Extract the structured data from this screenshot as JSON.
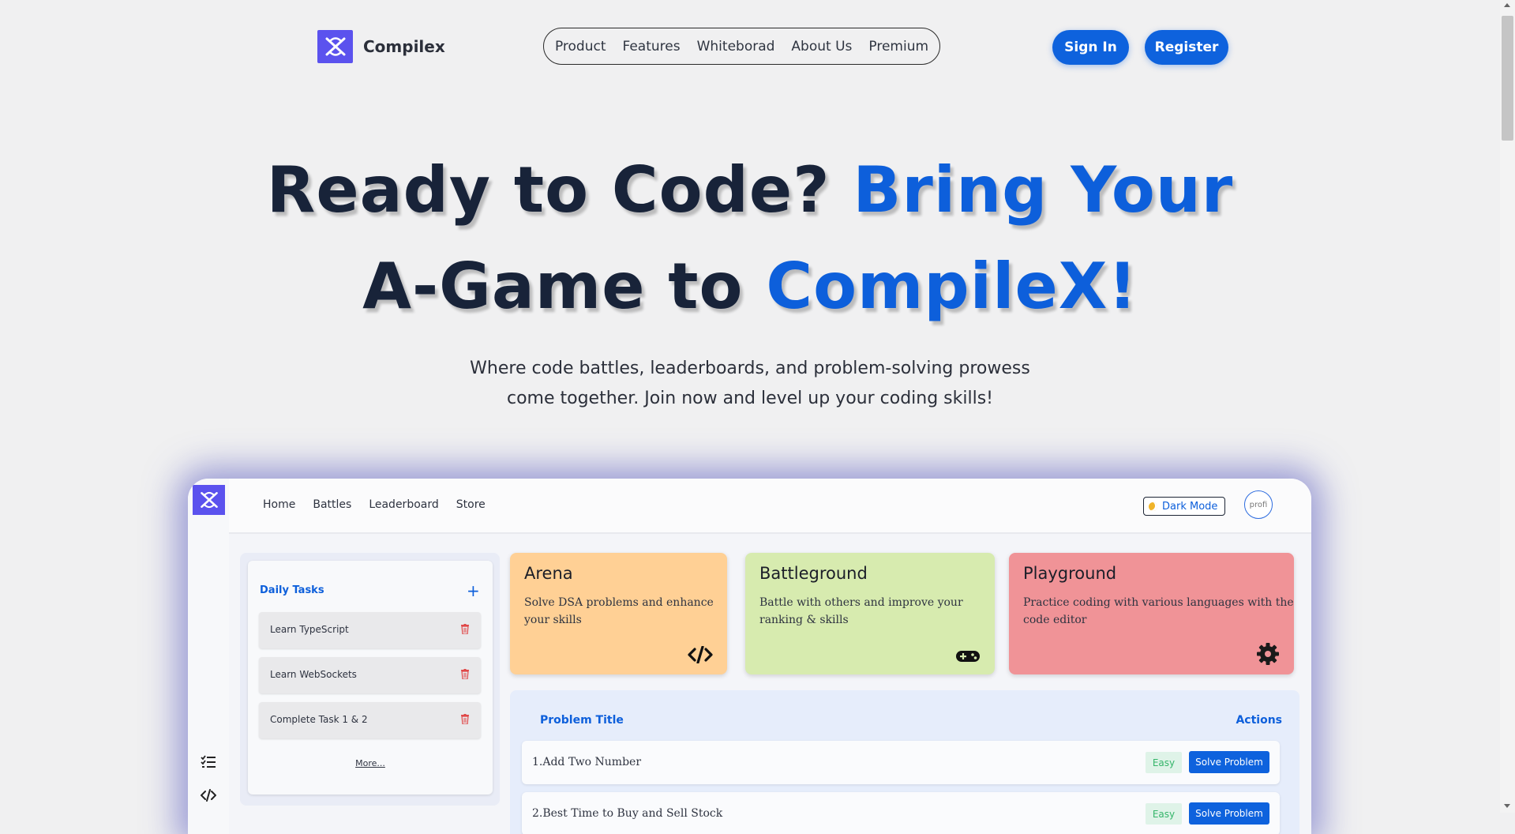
{
  "brand": {
    "name": "Compilex"
  },
  "nav": {
    "links": [
      "Product",
      "Features",
      "Whiteborad",
      "About Us",
      "Premium"
    ]
  },
  "auth": {
    "signin": "Sign In",
    "register": "Register"
  },
  "hero": {
    "title_part1": "Ready to Code? ",
    "title_accent1": "Bring Your",
    "title_part2": "A-Game to ",
    "title_accent2": "CompileX!",
    "subtitle_line1": "Where code battles, leaderboards, and problem-solving prowess",
    "subtitle_line2": "come together. Join now and level up your coding skills!"
  },
  "preview": {
    "menu": [
      "Home",
      "Battles",
      "Leaderboard",
      "Store"
    ],
    "dark_mode": "Dark Mode",
    "avatar_alt": "profi",
    "sidebar_icons": [
      "tasks-icon",
      "code-icon"
    ],
    "daily_tasks": {
      "title": "Daily Tasks",
      "add": "+",
      "items": [
        "Learn TypeScript",
        "Learn WebSockets",
        "Complete Task 1 & 2"
      ],
      "more": "More..."
    },
    "cards": [
      {
        "title": "Arena",
        "desc_line1": "Solve DSA problems and enhance",
        "desc_line2": "your skills",
        "icon": "code-icon",
        "color": "#ffd095"
      },
      {
        "title": "Battleground",
        "desc_line1": "Battle with others and improve your",
        "desc_line2": "ranking & skills",
        "icon": "gamepad-icon",
        "color": "#d7ebaf"
      },
      {
        "title": "Playground",
        "desc_line1": "Practice coding with various languages with the",
        "desc_line2": "code editor",
        "icon": "gear-icon",
        "color": "#f09397"
      }
    ],
    "problems": {
      "header_title": "Problem Title",
      "header_actions": "Actions",
      "rows": [
        {
          "name": "1.Add Two Number",
          "difficulty": "Easy",
          "action": "Solve Problem"
        },
        {
          "name": "2.Best Time to Buy and Sell Stock",
          "difficulty": "Easy",
          "action": "Solve Problem"
        }
      ]
    }
  },
  "colors": {
    "accent": "#0d5fdb",
    "logo": "#5b52ee",
    "heading": "#182339"
  }
}
